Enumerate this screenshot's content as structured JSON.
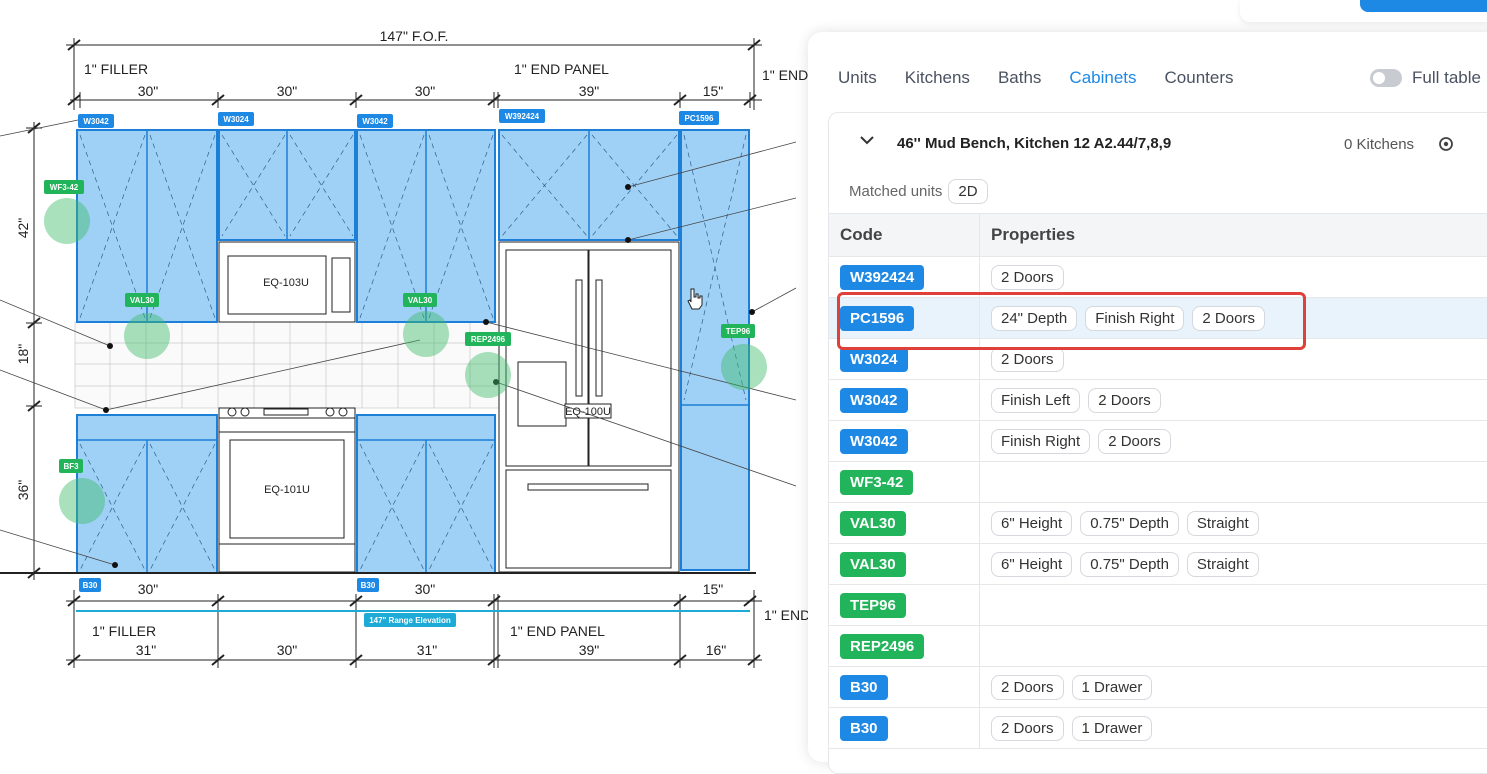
{
  "drawing": {
    "top_overall": "147\" F.O.F.",
    "top_dims": [
      "30\"",
      "30\"",
      "30\"",
      "39\"",
      "15\""
    ],
    "bottom_dims": [
      "30\"",
      "30\"",
      "15\""
    ],
    "bottom_overall": [
      "31\"",
      "30\"",
      "31\"",
      "39\"",
      "16\""
    ],
    "labels": {
      "filler_top": "1\" FILLER",
      "end_panel_top": "1\" END PANEL",
      "end_top": "1\" END",
      "filler_bottom": "1\" FILLER",
      "end_panel_bottom": "1\" END PANEL",
      "end_bottom": "1\" END"
    },
    "vert_dims": [
      "42\"",
      "18\"",
      "36\""
    ],
    "equipment": [
      "EQ-103U",
      "EQ-101U",
      "EQ-100U"
    ],
    "tags": {
      "w3042a": "W3042",
      "w3024": "W3024",
      "w3042b": "W3042",
      "w392424": "W392424",
      "pc1596": "PC1596",
      "wf342": "WF3-42",
      "val30a": "VAL30",
      "val30b": "VAL30",
      "rep2496": "REP2496",
      "tep96": "TEP96",
      "bf3": "BF3",
      "b30a": "B30",
      "b30b": "B30",
      "range": "147\" Range Elevation"
    },
    "colors": {
      "blue_tag": "#1e88e5",
      "green_tag": "#22b45a",
      "cabinet_fill": "#9fd0f5",
      "cabinet_stroke": "#1e7fd6"
    }
  },
  "panel": {
    "tabs": [
      "Units",
      "Kitchens",
      "Baths",
      "Cabinets",
      "Counters"
    ],
    "active_tab": "Cabinets",
    "toggle_label": "Full table",
    "card": {
      "title": "46'' Mud Bench, Kitchen 12 A2.44/7,8,9",
      "kitchen_count": "0 Kitchens",
      "matched_label": "Matched units",
      "matched_value": "2D",
      "headers": {
        "code": "Code",
        "properties": "Properties"
      },
      "rows": [
        {
          "code": "W392424",
          "color": "#1e88e5",
          "props": [
            "2 Doors"
          ]
        },
        {
          "code": "PC1596",
          "color": "#1e88e5",
          "props": [
            "24\" Depth",
            "Finish Right",
            "2 Doors"
          ],
          "selected": true
        },
        {
          "code": "W3024",
          "color": "#1e88e5",
          "props": [
            "2 Doors"
          ]
        },
        {
          "code": "W3042",
          "color": "#1e88e5",
          "props": [
            "Finish Left",
            "2 Doors"
          ]
        },
        {
          "code": "W3042",
          "color": "#1e88e5",
          "props": [
            "Finish Right",
            "2 Doors"
          ]
        },
        {
          "code": "WF3-42",
          "color": "#22b45a",
          "props": []
        },
        {
          "code": "VAL30",
          "color": "#22b45a",
          "props": [
            "6\" Height",
            "0.75\" Depth",
            "Straight"
          ]
        },
        {
          "code": "VAL30",
          "color": "#22b45a",
          "props": [
            "6\" Height",
            "0.75\" Depth",
            "Straight"
          ]
        },
        {
          "code": "TEP96",
          "color": "#22b45a",
          "props": []
        },
        {
          "code": "REP2496",
          "color": "#22b45a",
          "props": []
        },
        {
          "code": "B30",
          "color": "#1e88e5",
          "props": [
            "2 Doors",
            "1 Drawer"
          ]
        },
        {
          "code": "B30",
          "color": "#1e88e5",
          "props": [
            "2 Doors",
            "1 Drawer"
          ]
        }
      ]
    }
  }
}
